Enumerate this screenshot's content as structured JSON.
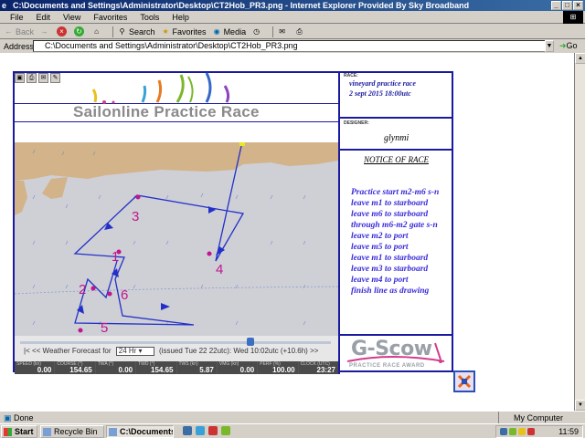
{
  "window": {
    "title": "C:\\Documents and Settings\\Administrator\\Desktop\\CT2Hob_PR3.png - Internet Explorer Provided By Sky Broadband",
    "controls": {
      "minimize": "_",
      "maximize": "□",
      "close": "×"
    }
  },
  "menu": [
    "File",
    "Edit",
    "View",
    "Favorites",
    "Tools",
    "Help"
  ],
  "toolbar": {
    "back": "Back",
    "search": "Search",
    "favorites": "Favorites",
    "media": "Media"
  },
  "address": {
    "label": "Address",
    "value": "C:\\Documents and Settings\\Administrator\\Desktop\\CT2Hob_PR3.png",
    "go": "Go"
  },
  "page": {
    "race_banner": "Sailonline Practice Race",
    "race_label": "RACE:",
    "race_name": "vineyard practice race",
    "race_date": "2 sept 2015 18:00utc",
    "designer_label": "DESIGNER:",
    "designer_name": "glynmi",
    "notice_title": "NOTICE OF RACE",
    "notice_lines": [
      "Practice start m2-m6 s-n",
      "leave m1 to starboard",
      "leave m6 to starboard",
      "through m6-m2 gate s-n",
      "leave m2 to port",
      "leave m5 to port",
      "leave m1 to starboard",
      "leave m3 to starboard",
      "leave m4 to port",
      "finish line as drawing"
    ],
    "gscow_title": "G-Scow",
    "gscow_sub": "PRACTICE RACE AWARD",
    "marks": [
      "1",
      "2",
      "3",
      "4",
      "5",
      "6"
    ]
  },
  "forecast": {
    "prefix": "|<  <<  Weather Forecast for",
    "select_value": "24 Hr",
    "issued": "(issued Tue 22 22utc): Wed 10:02utc (+10.6h)  >>",
    "slider_fraction": 0.78
  },
  "readouts": [
    {
      "label": "SPEED (kn)",
      "value": "0.00"
    },
    {
      "label": "COURSE (°)",
      "value": "154.65"
    },
    {
      "label": "TWA (°)",
      "value": "0.00"
    },
    {
      "label": "TWD (°)",
      "value": "154.65"
    },
    {
      "label": "TWS (kn)",
      "value": "5.87"
    },
    {
      "label": "VMG (kn)",
      "value": "0.00"
    },
    {
      "label": "PERF (%)",
      "value": "100.00"
    },
    {
      "label": "CLOCK (UTC)",
      "value": "23:27"
    }
  ],
  "status": {
    "left": "Done",
    "right": "My Computer"
  },
  "taskbar": {
    "start": "Start",
    "tasks": [
      "Recycle Bin",
      "C:\\Documents..."
    ],
    "clock": "11:59"
  },
  "colors": {
    "frame": "#1a1aa0",
    "annotation": "#c0168c",
    "course": "#2230c8",
    "land": "#d2b38a",
    "water": "#cfcfd6"
  }
}
